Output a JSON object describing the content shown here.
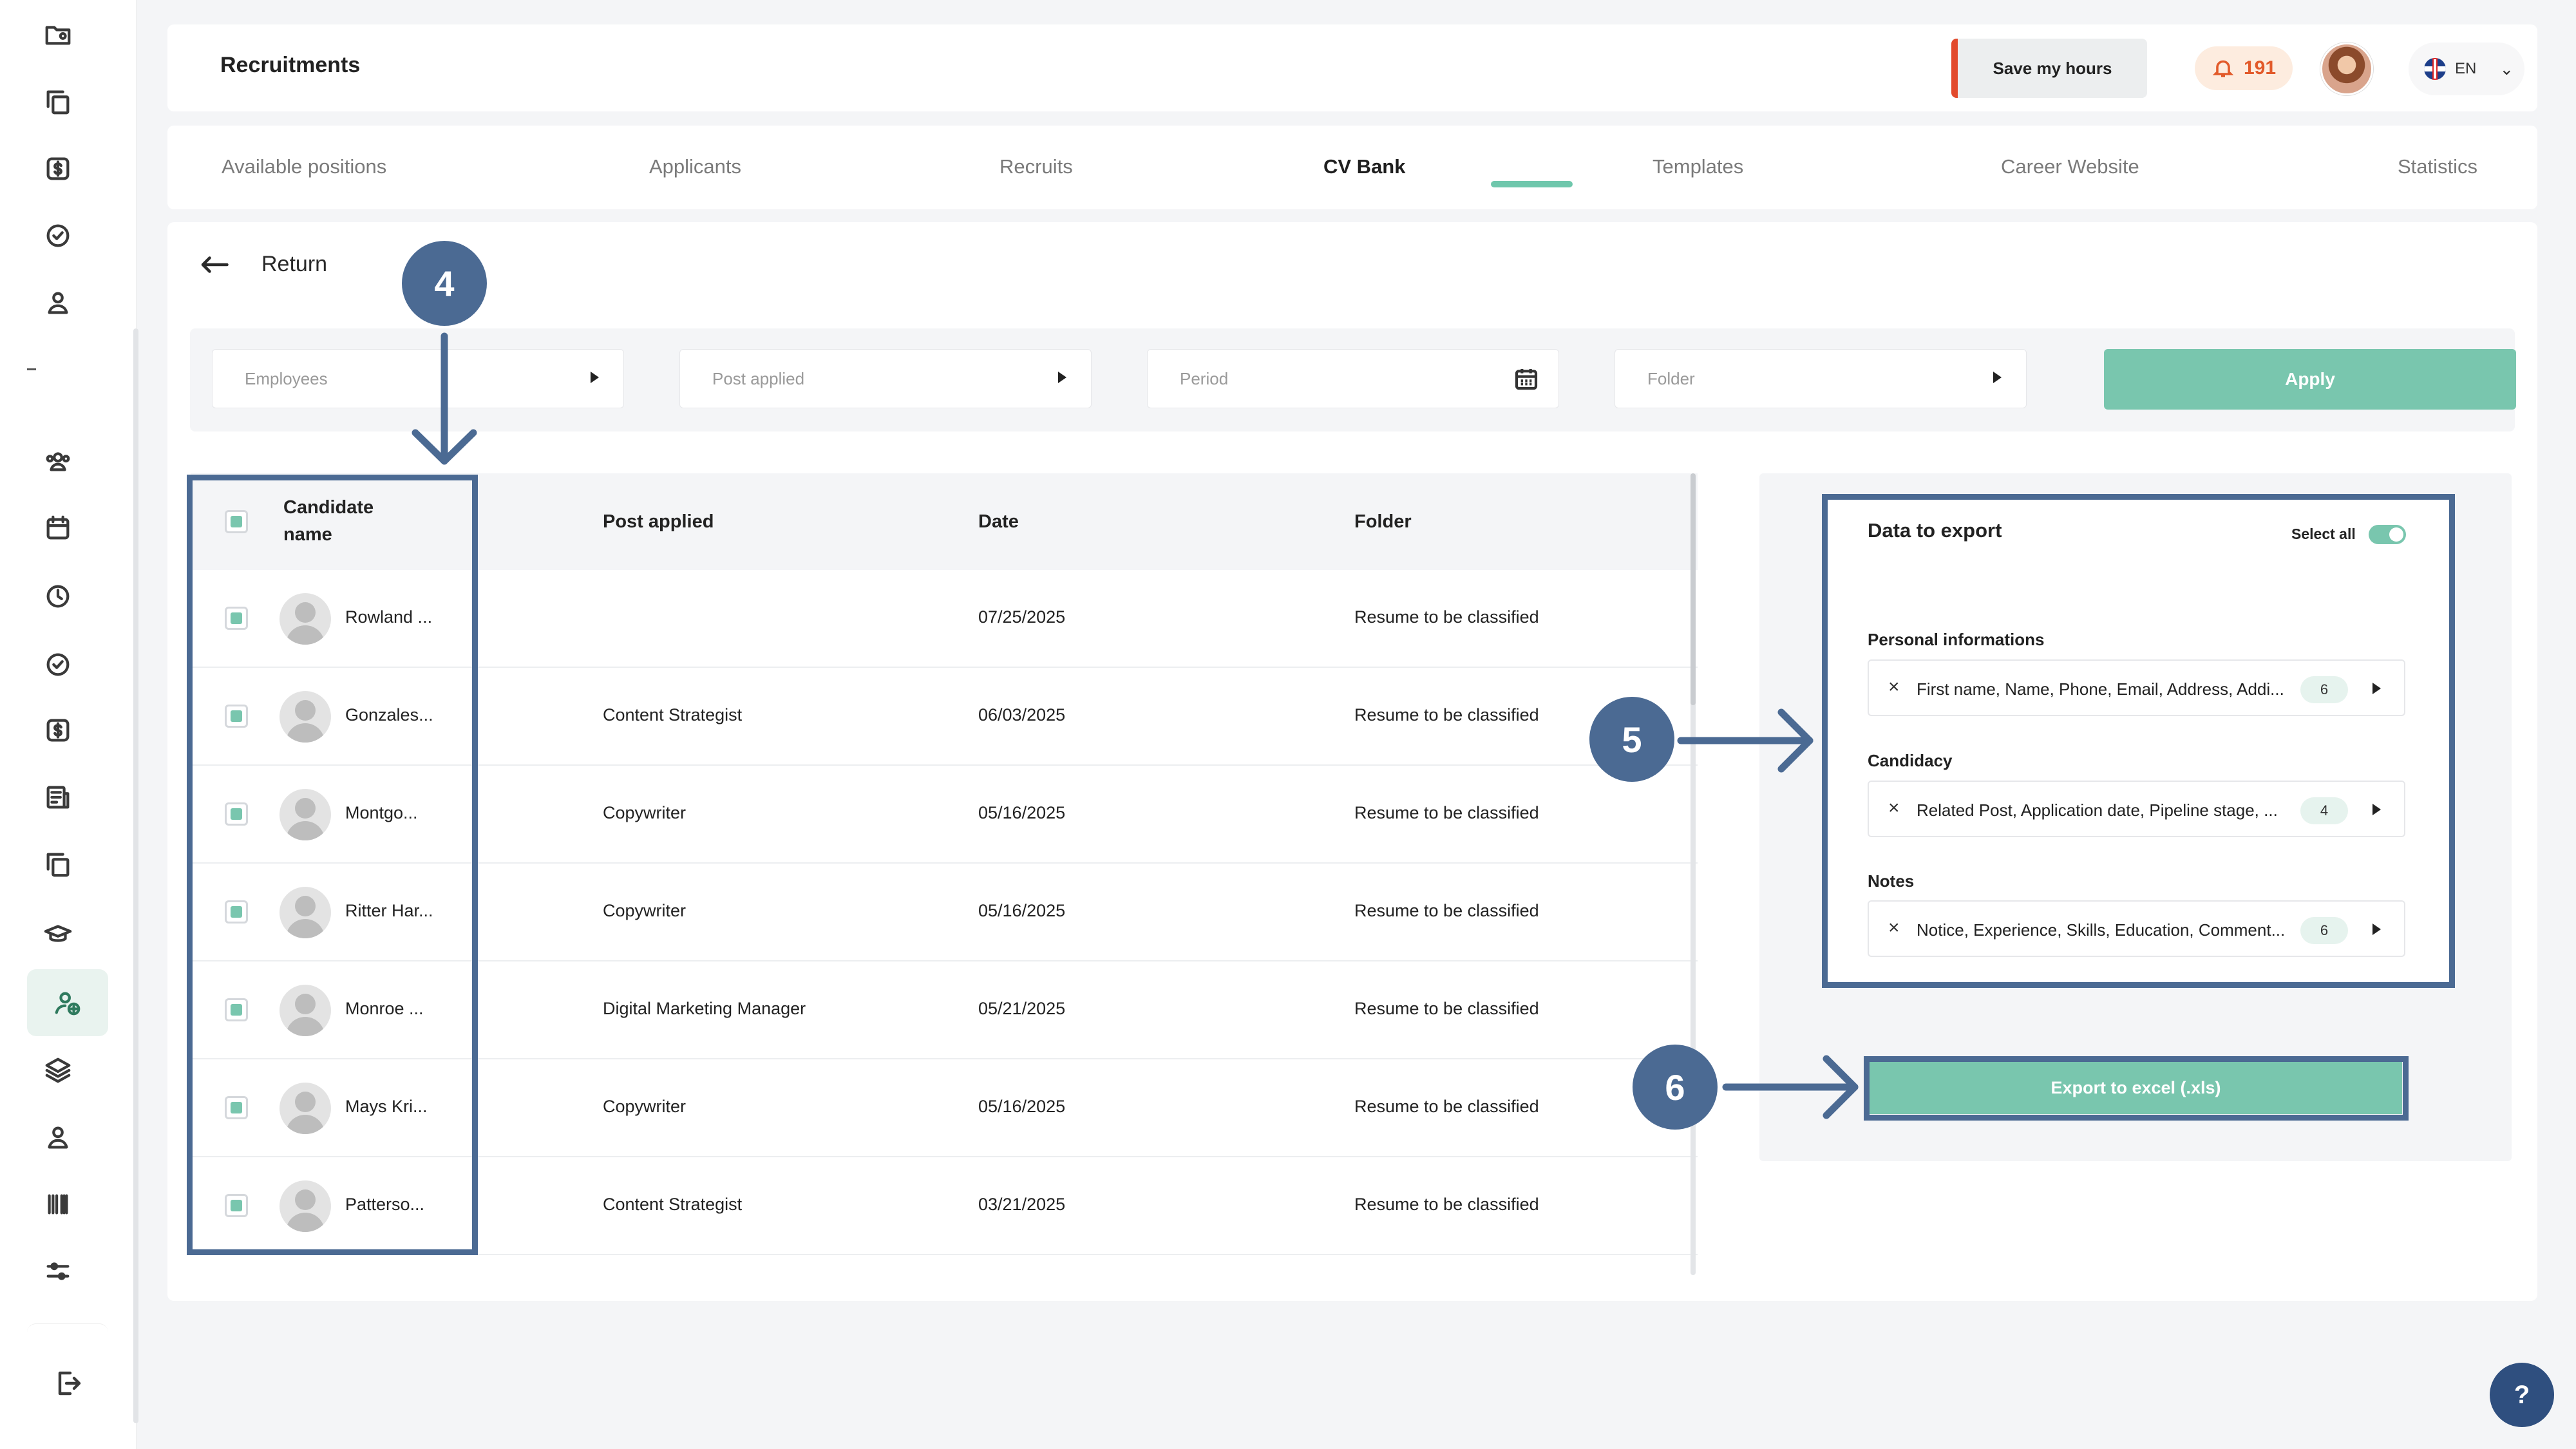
{
  "sidebar": {
    "icons": [
      "folder-user-icon",
      "copy-icon",
      "dollar-icon",
      "check-circle-icon",
      "user-icon",
      "users-icon",
      "calendar-icon",
      "clock-icon",
      "check-circle-icon",
      "dollar-icon",
      "document-icon",
      "copy-icon",
      "graduation-cap-icon",
      "user-plus-icon",
      "layers-icon",
      "user-icon",
      "barcode-icon",
      "sliders-icon"
    ],
    "active": "user-plus-icon",
    "logout_icon": "logout-icon"
  },
  "header": {
    "title": "Recruitments",
    "save_hours_label": "Save my hours",
    "notification_count": "191",
    "language": "EN"
  },
  "tabs": [
    {
      "label": "Available positions"
    },
    {
      "label": "Applicants"
    },
    {
      "label": "Recruits"
    },
    {
      "label": "CV Bank",
      "active": true
    },
    {
      "label": "Templates"
    },
    {
      "label": "Career Website"
    },
    {
      "label": "Statistics"
    }
  ],
  "content": {
    "return_label": "Return",
    "filters": {
      "employees": "Employees",
      "post_applied": "Post applied",
      "period": "Period",
      "folder": "Folder",
      "apply_label": "Apply"
    },
    "table": {
      "headers": {
        "candidate_name": "Candidate name",
        "post_applied": "Post applied",
        "date": "Date",
        "folder": "Folder"
      },
      "rows": [
        {
          "name": "Rowland ...",
          "post": "",
          "date": "07/25/2025",
          "folder": "Resume to be classified"
        },
        {
          "name": "Gonzales...",
          "post": "Content Strategist",
          "date": "06/03/2025",
          "folder": "Resume to be classified"
        },
        {
          "name": "Montgo...",
          "post": "Copywriter",
          "date": "05/16/2025",
          "folder": "Resume to be classified"
        },
        {
          "name": "Ritter Har...",
          "post": "Copywriter",
          "date": "05/16/2025",
          "folder": "Resume to be classified"
        },
        {
          "name": "Monroe ...",
          "post": "Digital Marketing Manager",
          "date": "05/21/2025",
          "folder": "Resume to be classified"
        },
        {
          "name": "Mays Kri...",
          "post": "Copywriter",
          "date": "05/16/2025",
          "folder": "Resume to be classified"
        },
        {
          "name": "Patterso...",
          "post": "Content Strategist",
          "date": "03/21/2025",
          "folder": "Resume to be classified"
        }
      ]
    },
    "export": {
      "title": "Data to export",
      "select_all_label": "Select all",
      "select_all_on": true,
      "sections": [
        {
          "label": "Personal informations",
          "value": "First name, Name, Phone, Email, Address, Addi...",
          "count": "6"
        },
        {
          "label": "Candidacy",
          "value": "Related Post, Application date, Pipeline stage, ...",
          "count": "4"
        },
        {
          "label": "Notes",
          "value": "Notice, Experience, Skills, Education, Comment...",
          "count": "6"
        }
      ],
      "export_button_label": "Export to excel (.xls)"
    }
  },
  "annotations": [
    "4",
    "5",
    "6"
  ],
  "help_label": "?",
  "colors": {
    "accent": "#79c6ae",
    "annotation": "#4b6a93",
    "alert": "#e24a2c"
  }
}
